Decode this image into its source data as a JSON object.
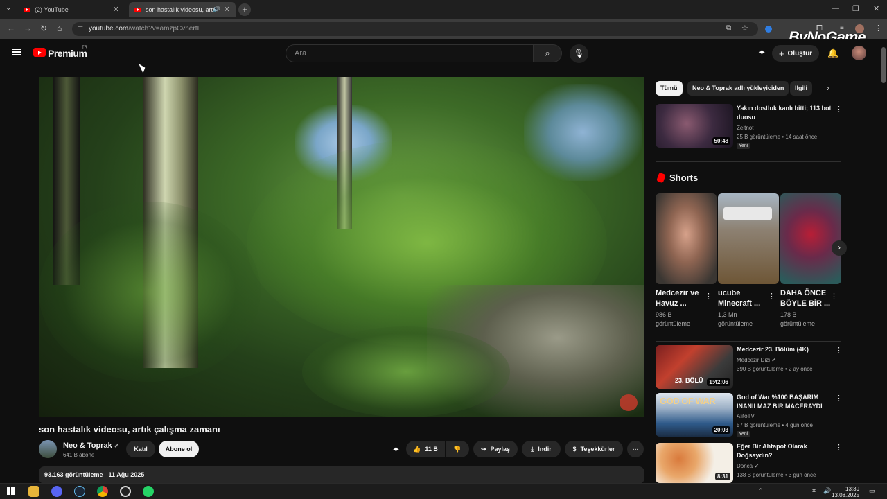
{
  "browser": {
    "tabs": [
      {
        "title": "(2) YouTube"
      },
      {
        "title": "son hastalık videosu, artık ç"
      }
    ],
    "new_tab": "+",
    "url_host": "youtube.com",
    "url_path": "/watch?v=amzpCvnertI"
  },
  "header": {
    "brand": "Premium",
    "region": "TR",
    "search_placeholder": "Ara",
    "create_label": "Oluştur"
  },
  "watermark": {
    "prefix": "By",
    "main": "NoGame"
  },
  "video": {
    "title": "son hastalık videosu, artık çalışma zamanı",
    "channel": "Neo & Toprak",
    "subscribers": "641 B abone",
    "join_label": "Katıl",
    "subscribe_label": "Abone ol",
    "likes": "11 B",
    "share_label": "Paylaş",
    "download_label": "İndir",
    "thanks_label": "Teşekkürler",
    "views": "93.163 görüntüleme",
    "date": "11 Ağu 2025"
  },
  "chips": [
    "Tümü",
    "Neo & Toprak adlı yükleyiciden",
    "İlgili"
  ],
  "recommended_top": {
    "title_line1": "Yakın dostluk kanlı bitti; 113 bot",
    "title_line2": "duosu",
    "channel": "Zeitnot",
    "meta": "25 B görüntüleme • 14 saat önce",
    "badge": "Yeni",
    "duration": "50:48"
  },
  "shorts": {
    "header": "Shorts",
    "items": [
      {
        "line1": "Medcezir ve",
        "line2": "Havuz ...",
        "views1": "986 B",
        "views2": "görüntüleme"
      },
      {
        "line1": "ucube",
        "line2": "Minecraft ...",
        "views1": "1,3 Mn",
        "views2": "görüntüleme"
      },
      {
        "line1": "DAHA ÖNCE",
        "line2": "BÖYLE BİR ...",
        "views1": "178 B",
        "views2": "görüntüleme"
      }
    ]
  },
  "recommended": [
    {
      "title_line1": "Medcezir 23. Bölüm (4K)",
      "title_line2": "",
      "channel": "Medcezir Dizi",
      "meta": "390 B görüntüleme • 2 ay önce",
      "badge": "",
      "duration": "1:42:06",
      "thumb_text": "23. BÖLÜ"
    },
    {
      "title_line1": "God of War %100 BAŞARIM",
      "title_line2": "İNANILMAZ BİR MACERAYDI",
      "channel": "AlitoTV",
      "meta": "57 B görüntüleme • 4 gün önce",
      "badge": "Yeni",
      "duration": "20:03",
      "thumb_text": "GOD OF WAR"
    },
    {
      "title_line1": "Eğer Bir Ahtapot Olarak",
      "title_line2": "Doğsaydın?",
      "channel": "Donca",
      "meta": "138 B görüntüleme • 3 gün önce",
      "badge": "",
      "duration": "8:31",
      "thumb_text": ""
    }
  ],
  "taskbar": {
    "time": "13:39",
    "date": "13.08.2025"
  },
  "colors": {
    "youtube_red": "#ff0000",
    "background": "#0f0f0f",
    "chip_bg": "#272727"
  }
}
